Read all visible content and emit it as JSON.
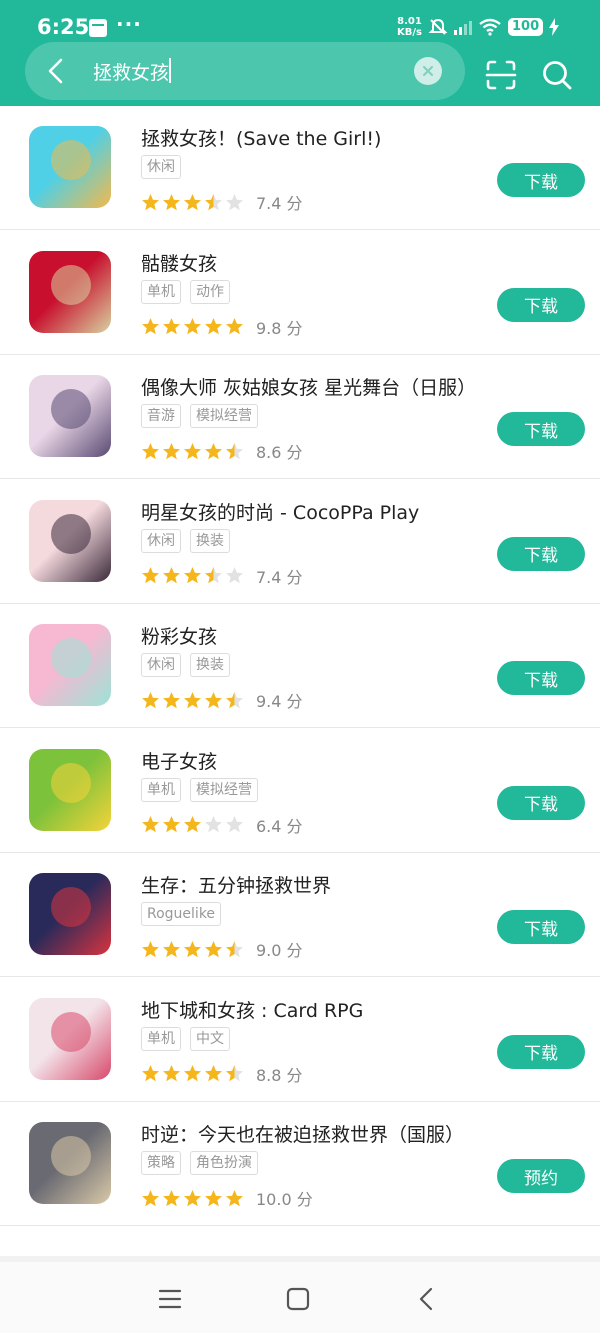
{
  "status_bar": {
    "time": "6:25",
    "dots": "···",
    "speed_value": "8.01",
    "speed_unit": "KB/s",
    "battery": "100"
  },
  "search": {
    "query": "拯救女孩"
  },
  "results": [
    {
      "title": "拯救女孩！(Save the Girl!)",
      "tags": [
        "休闲"
      ],
      "rating": 3.5,
      "score": "7.4 分",
      "action": "下载",
      "icon": "save-the-girl-icon",
      "colors": [
        "#4fd0e6",
        "#f3b94b"
      ]
    },
    {
      "title": "骷髅女孩",
      "tags": [
        "单机",
        "动作"
      ],
      "rating": 5,
      "score": "9.8 分",
      "action": "下载",
      "icon": "skullgirls-icon",
      "colors": [
        "#c8102e",
        "#d8d2a0"
      ]
    },
    {
      "title": "偶像大师 灰姑娘女孩 星光舞台（日服）",
      "tags": [
        "音游",
        "模拟经营"
      ],
      "rating": 4.5,
      "score": "8.6 分",
      "action": "下载",
      "icon": "idolmaster-icon",
      "colors": [
        "#e9d6e6",
        "#5a4a72"
      ]
    },
    {
      "title": "明星女孩的时尚 - CocoPPa Play",
      "tags": [
        "休闲",
        "换装"
      ],
      "rating": 3.5,
      "score": "7.4 分",
      "action": "下载",
      "icon": "cocoppa-icon",
      "colors": [
        "#f4d9dd",
        "#3b2a3a"
      ]
    },
    {
      "title": "粉彩女孩",
      "tags": [
        "休闲",
        "换装"
      ],
      "rating": 4.5,
      "score": "9.4 分",
      "action": "下载",
      "icon": "pastel-girl-icon",
      "colors": [
        "#f7b8d2",
        "#9be3d6"
      ]
    },
    {
      "title": "电子女孩",
      "tags": [
        "单机",
        "模拟经营"
      ],
      "rating": 3,
      "score": "6.4 分",
      "action": "下载",
      "icon": "tamagotchi-icon",
      "colors": [
        "#7dc23b",
        "#f5d33a"
      ]
    },
    {
      "title": "生存：五分钟拯救世界",
      "tags": [
        "Roguelike"
      ],
      "rating": 4.5,
      "score": "9.0 分",
      "action": "下载",
      "icon": "survive-icon",
      "colors": [
        "#2a2a5a",
        "#d8343f"
      ]
    },
    {
      "title": "地下城和女孩 : Card RPG",
      "tags": [
        "单机",
        "中文"
      ],
      "rating": 4.5,
      "score": "8.8 分",
      "action": "下载",
      "icon": "dungeon-girl-icon",
      "colors": [
        "#f3e4ea",
        "#d84a6b"
      ]
    },
    {
      "title": "时逆：今天也在被迫拯救世界（国服）",
      "tags": [
        "策略",
        "角色扮演"
      ],
      "rating": 5,
      "score": "10.0 分",
      "action": "预约",
      "icon": "shini-icon",
      "colors": [
        "#6a6a72",
        "#d9c9a8"
      ]
    }
  ],
  "colors": {
    "brand": "#22b89a",
    "star_filled": "#f5b61b",
    "star_empty": "#e2e2e2"
  }
}
